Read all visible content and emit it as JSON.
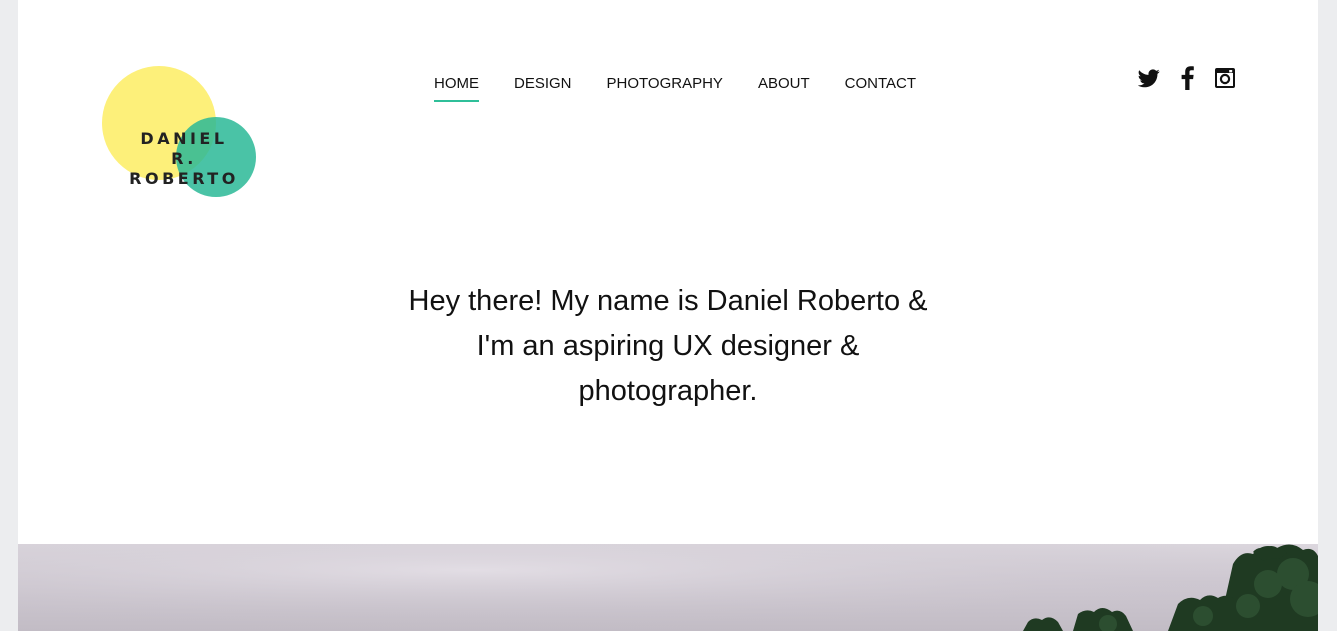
{
  "logo": {
    "line1": "DANIEL R.",
    "line2": "ROBERTO",
    "colors": {
      "yellow": "#fdf07a",
      "green": "#2ab996"
    }
  },
  "nav": {
    "items": [
      {
        "label": "HOME",
        "active": true
      },
      {
        "label": "DESIGN",
        "active": false
      },
      {
        "label": "PHOTOGRAPHY",
        "active": false
      },
      {
        "label": "ABOUT",
        "active": false
      },
      {
        "label": "CONTACT",
        "active": false
      }
    ],
    "accent_color": "#2fbf99"
  },
  "social": {
    "icons": [
      "twitter-icon",
      "facebook-icon",
      "instagram-icon"
    ]
  },
  "hero": {
    "line1": "Hey there! My name is Daniel Roberto &",
    "line2": "I'm an aspiring UX designer &",
    "line3": "photographer."
  },
  "photo": {
    "icon": "landscape-photo"
  }
}
